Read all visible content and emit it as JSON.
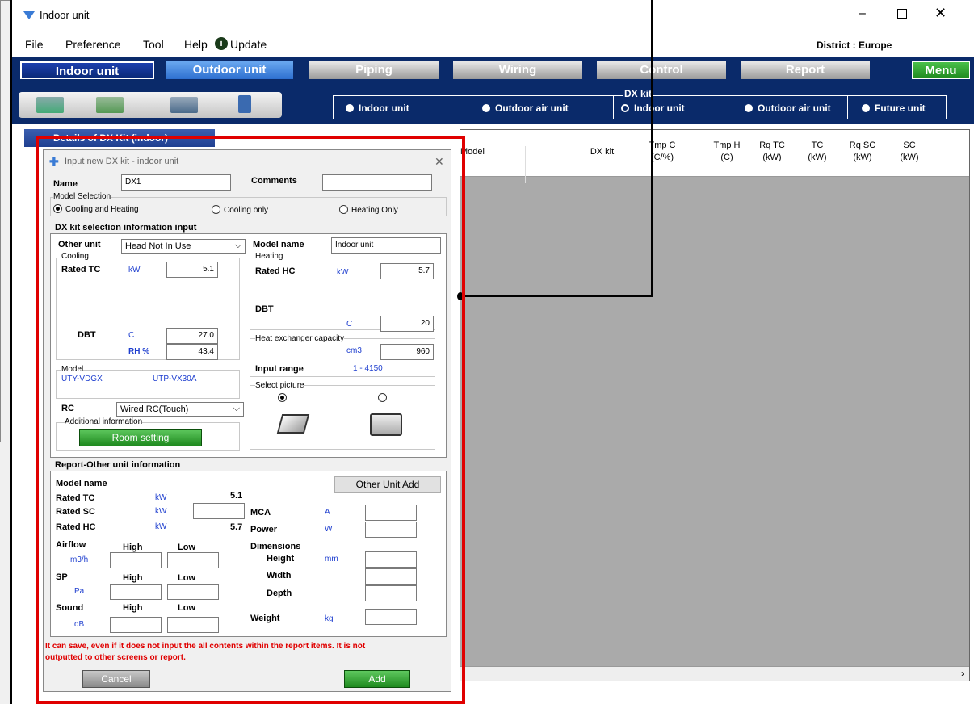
{
  "window": {
    "title": "Indoor unit",
    "district": "District : Europe"
  },
  "menu": [
    "File",
    "Preference",
    "Tool",
    "Help",
    "Update"
  ],
  "nav": {
    "indoor": "Indoor unit",
    "outdoor": "Outdoor unit",
    "piping": "Piping",
    "wiring": "Wiring",
    "control": "Control",
    "report": "Report",
    "menu": "Menu"
  },
  "unit_selector": {
    "indoor": "Indoor unit",
    "outdoor_air": "Outdoor air unit",
    "dxkit_label": "DX kit",
    "dx_indoor": "Indoor unit",
    "dx_outdoor_air": "Outdoor air unit",
    "future": "Future unit"
  },
  "grid_headers": [
    {
      "l1": "Model",
      "l2": ""
    },
    {
      "l1": "DX kit",
      "l2": ""
    },
    {
      "l1": "Tmp C",
      "l2": "(C/%)"
    },
    {
      "l1": "Tmp H",
      "l2": "(C)"
    },
    {
      "l1": "Rq TC",
      "l2": "(kW)"
    },
    {
      "l1": "TC",
      "l2": "(kW)"
    },
    {
      "l1": "Rq SC",
      "l2": "(kW)"
    },
    {
      "l1": "SC",
      "l2": "(kW)"
    }
  ],
  "left_panel": {
    "details_title": "Details of DX Kit (indoor)"
  },
  "dialog": {
    "title": "Input new DX kit - indoor unit",
    "name_label": "Name",
    "name_value": "DX1",
    "comments_label": "Comments",
    "comments_value": "",
    "model_selection": "Model Selection",
    "opt_cool_heat": "Cooling and Heating",
    "opt_cool": "Cooling only",
    "opt_heat": "Heating Only",
    "sel_info": "DX kit selection information input",
    "other_unit": "Other unit",
    "other_unit_value": "Head Not In Use",
    "model_name_label": "Model name",
    "model_name_value": "Indoor unit",
    "cooling": "Cooling",
    "heating": "Heating",
    "rated_tc": "Rated TC",
    "rated_hc": "Rated HC",
    "kw": "kW",
    "tc_value": "5.1",
    "hc_value": "5.7",
    "dbt": "DBT",
    "c": "C",
    "rh": "RH %",
    "dbt_h_value": "20",
    "dbt_c_value": "27.0",
    "rh_value": "43.4",
    "hex_cap": "Heat exchanger capacity",
    "cm3": "cm3",
    "hex_value": "960",
    "input_range": "Input range",
    "input_range_value": "1 - 4150",
    "model": "Model",
    "model_a": "UTY-VDGX",
    "model_b": "UTP-VX30A",
    "select_picture": "Select picture",
    "rc": "RC",
    "rc_value": "Wired RC(Touch)",
    "additional": "Additional information",
    "room_setting": "Room setting",
    "report_title": "Report-Other unit information",
    "r_model_name": "Model name",
    "other_unit_add": "Other Unit Add",
    "r_rated_tc": "Rated TC",
    "r_tc_val": "5.1",
    "r_rated_sc": "Rated SC",
    "r_rated_hc": "Rated HC",
    "r_hc_val": "5.7",
    "mca": "MCA",
    "a": "A",
    "power": "Power",
    "w": "W",
    "airflow": "Airflow",
    "m3h": "m3/h",
    "high": "High",
    "low": "Low",
    "dimensions": "Dimensions",
    "height": "Height",
    "mm": "mm",
    "width": "Width",
    "depth": "Depth",
    "sp": "SP",
    "pa": "Pa",
    "sound": "Sound",
    "db": "dB",
    "weight": "Weight",
    "kg": "kg",
    "note1": "It can save, even if it does not input the all contents within the report items. It is not",
    "note2": "outputted to other screens or report.",
    "cancel": "Cancel",
    "add": "Add"
  }
}
